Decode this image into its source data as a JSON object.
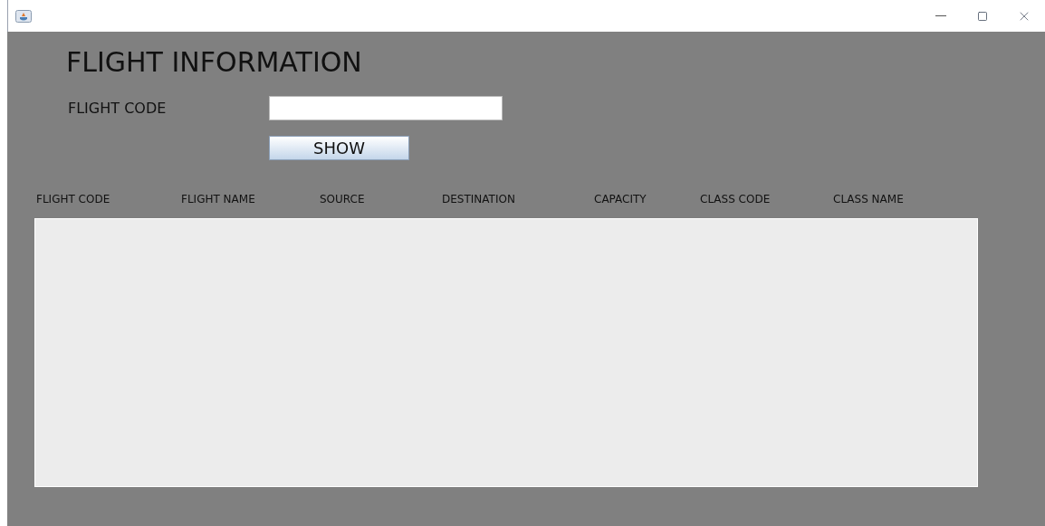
{
  "title": "FLIGHT INFORMATION",
  "search": {
    "label": "FLIGHT CODE",
    "button": "SHOW"
  },
  "table": {
    "columns": [
      "FLIGHT CODE",
      "FLIGHT NAME",
      "SOURCE",
      "DESTINATION",
      "CAPACITY",
      "CLASS CODE",
      "CLASS NAME"
    ]
  }
}
